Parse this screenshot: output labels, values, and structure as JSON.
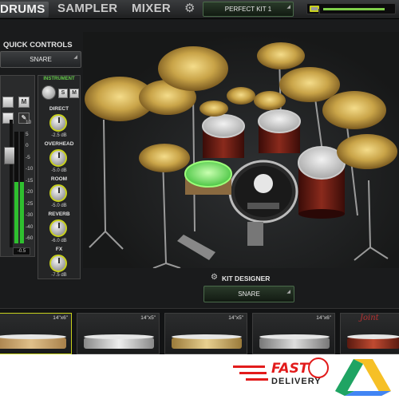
{
  "nav": {
    "tabs": [
      {
        "label": "DRUMS",
        "active": true
      },
      {
        "label": "SAMPLER",
        "active": false
      },
      {
        "label": "MIXER",
        "active": false
      }
    ],
    "kit_preset": "PERFECT KIT 1",
    "settings_icon": "gear-icon",
    "master_volume_level": 0.92
  },
  "quick_controls": {
    "title": "QUICK CONTROLS",
    "selected_instrument": "SNARE"
  },
  "channel_strip": {
    "buttons": [
      "M"
    ],
    "scale": [
      "10",
      "5",
      "0",
      "-5",
      "-10",
      "-15",
      "-20",
      "-25",
      "-30",
      "-40",
      "-60"
    ],
    "fader_value": "-0.5",
    "meter_level": 0.55
  },
  "instrument_panel": {
    "label": "INSTRUMENT",
    "solo_label": "S",
    "mute_label": "M",
    "knobs": [
      {
        "label": "DIRECT",
        "value": "-2.5 dB"
      },
      {
        "label": "OVERHEAD",
        "value": "-5.0 dB"
      },
      {
        "label": "ROOM",
        "value": "-5.0 dB"
      },
      {
        "label": "REVERB",
        "value": "-6.0 dB"
      },
      {
        "label": "FX",
        "value": "-7.5 dB"
      }
    ]
  },
  "kit_designer": {
    "title": "KIT DESIGNER",
    "selected": "SNARE"
  },
  "snare_tray": {
    "slots": [
      {
        "size": "14\"x6\"",
        "active": true
      },
      {
        "size": "14\"x5\"",
        "active": false
      },
      {
        "size": "14\"x5\"",
        "active": false
      },
      {
        "size": "14\"x6\"",
        "active": false
      },
      {
        "size": "",
        "logo": "Joint",
        "active": false
      }
    ]
  },
  "promo": {
    "fast": "FAST",
    "delivery": "DELIVERY"
  },
  "colors": {
    "accent_green": "#64c74a",
    "knob_ring": "#c8d11c",
    "cymbal_gold": "#c9a448",
    "shell_red": "#6e1c14"
  }
}
